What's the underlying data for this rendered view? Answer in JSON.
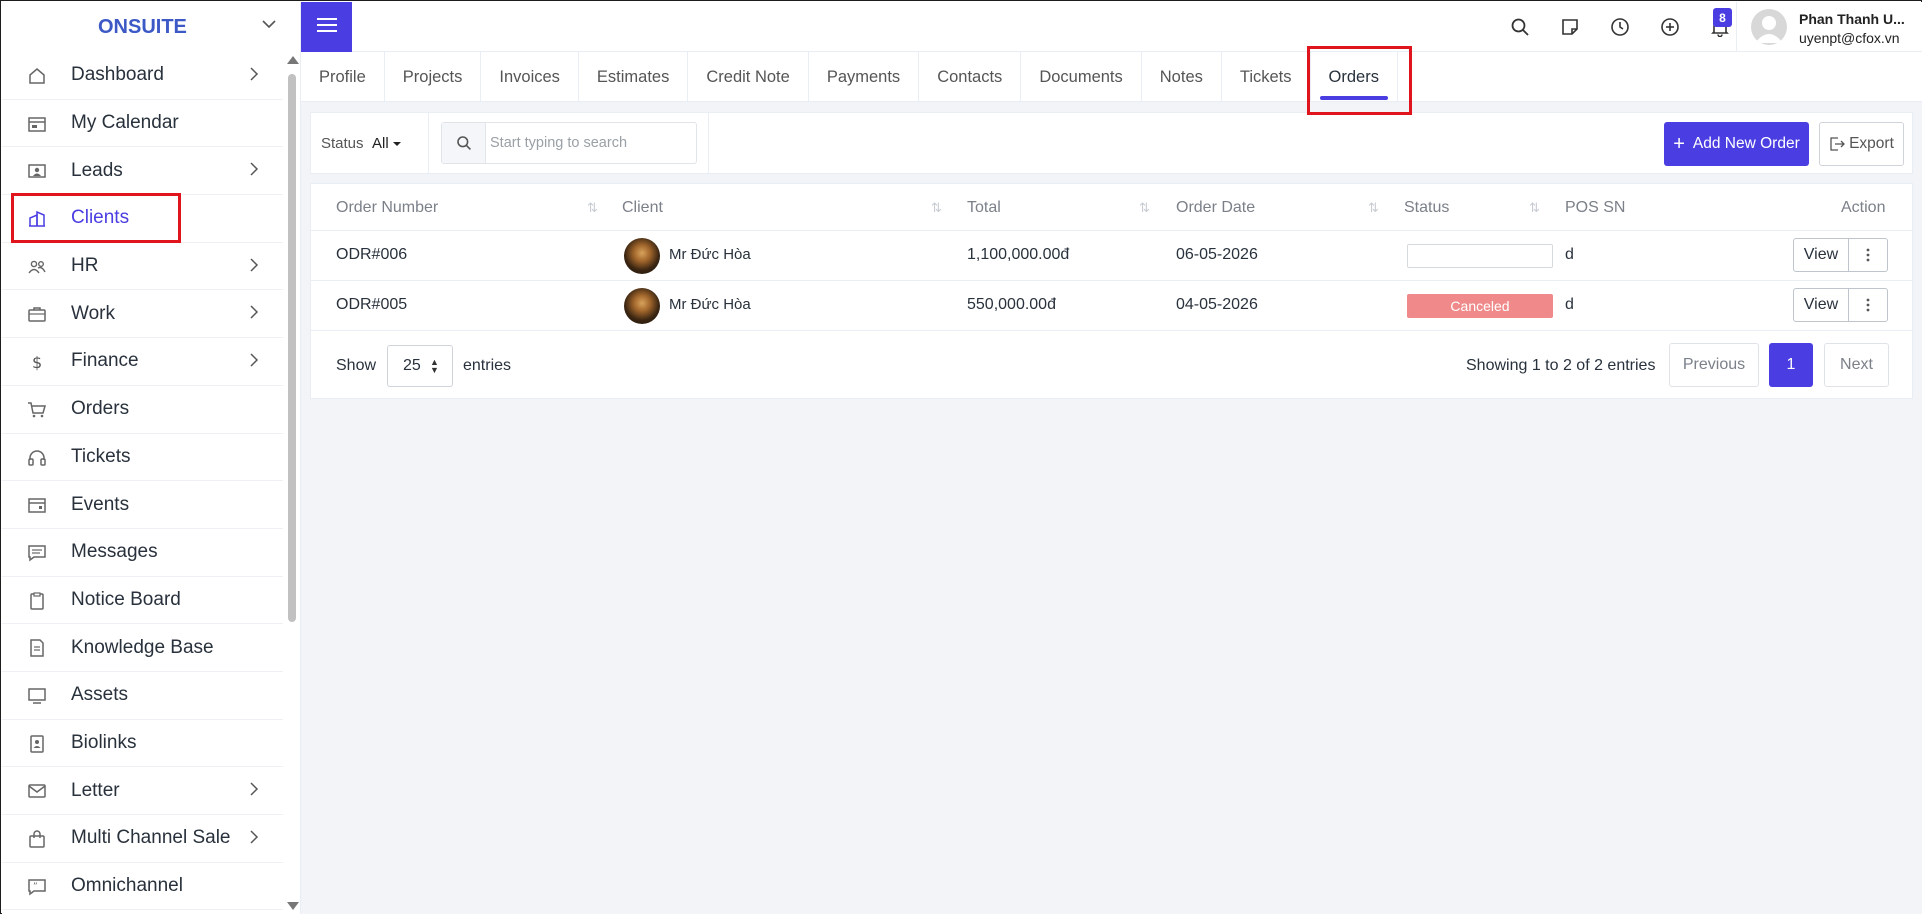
{
  "brand": {
    "name": "ONSUITE"
  },
  "sidebar": {
    "items": [
      {
        "label": "Dashboard",
        "icon": "home-icon",
        "has_arrow": true
      },
      {
        "label": "My Calendar",
        "icon": "calendar-icon",
        "has_arrow": false
      },
      {
        "label": "Leads",
        "icon": "person-card-icon",
        "has_arrow": true
      },
      {
        "label": "Clients",
        "icon": "building-icon",
        "has_arrow": false,
        "active": true
      },
      {
        "label": "HR",
        "icon": "people-icon",
        "has_arrow": true
      },
      {
        "label": "Work",
        "icon": "briefcase-icon",
        "has_arrow": true
      },
      {
        "label": "Finance",
        "icon": "dollar-icon",
        "has_arrow": true
      },
      {
        "label": "Orders",
        "icon": "cart-icon",
        "has_arrow": false
      },
      {
        "label": "Tickets",
        "icon": "headset-icon",
        "has_arrow": false
      },
      {
        "label": "Events",
        "icon": "calendar-event-icon",
        "has_arrow": false
      },
      {
        "label": "Messages",
        "icon": "message-icon",
        "has_arrow": false
      },
      {
        "label": "Notice Board",
        "icon": "clipboard-icon",
        "has_arrow": false
      },
      {
        "label": "Knowledge Base",
        "icon": "document-icon",
        "has_arrow": false
      },
      {
        "label": "Assets",
        "icon": "monitor-icon",
        "has_arrow": false
      },
      {
        "label": "Biolinks",
        "icon": "badge-icon",
        "has_arrow": false
      },
      {
        "label": "Letter",
        "icon": "envelope-icon",
        "has_arrow": true
      },
      {
        "label": "Multi Channel Sale",
        "icon": "bag-icon",
        "has_arrow": true
      },
      {
        "label": "Omnichannel",
        "icon": "chat-quote-icon",
        "has_arrow": false
      }
    ]
  },
  "topbar": {
    "notification_count": "8",
    "user": {
      "name": "Phan Thanh U...",
      "email": "uyenpt@cfox.vn"
    }
  },
  "tabs": [
    {
      "label": "Profile"
    },
    {
      "label": "Projects"
    },
    {
      "label": "Invoices"
    },
    {
      "label": "Estimates"
    },
    {
      "label": "Credit Note"
    },
    {
      "label": "Payments"
    },
    {
      "label": "Contacts"
    },
    {
      "label": "Documents"
    },
    {
      "label": "Notes"
    },
    {
      "label": "Tickets"
    },
    {
      "label": "Orders",
      "active": true
    }
  ],
  "filters": {
    "status_label": "Status",
    "status_value": "All",
    "search_placeholder": "Start typing to search"
  },
  "actions": {
    "add_label": "Add New Order",
    "export_label": "Export"
  },
  "table": {
    "columns": [
      "Order Number",
      "Client",
      "Total",
      "Order Date",
      "Status",
      "POS SN",
      "Action"
    ],
    "rows": [
      {
        "order_number": "ODR#006",
        "client": "Mr Đức Hòa",
        "total": "1,100,000.00đ",
        "order_date": "06-05-2026",
        "status": "",
        "pos_sn": "d",
        "view": "View"
      },
      {
        "order_number": "ODR#005",
        "client": "Mr Đức Hòa",
        "total": "550,000.00đ",
        "order_date": "04-05-2026",
        "status": "Canceled",
        "pos_sn": "d",
        "view": "View"
      }
    ]
  },
  "pagination": {
    "show_label": "Show",
    "page_size": "25",
    "entries_label": "entries",
    "info": "Showing 1 to 2 of 2 entries",
    "previous": "Previous",
    "current": "1",
    "next": "Next"
  },
  "colors": {
    "accent": "#4a3ee2",
    "highlight": "#e0141c",
    "canceled": "#f08a8a"
  }
}
